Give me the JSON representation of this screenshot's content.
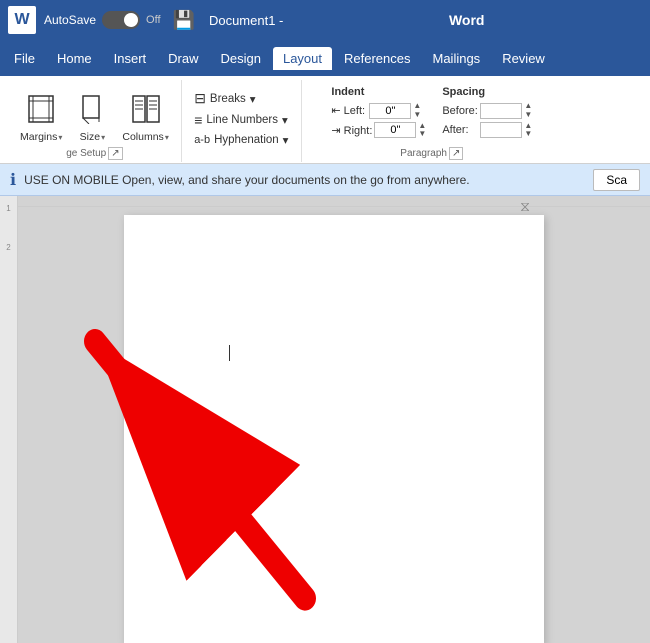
{
  "titlebar": {
    "logo": "W",
    "autosave_label": "AutoSave",
    "toggle_state": "Off",
    "save_label": "💾",
    "doc_name": "Document1",
    "separator": "  -  ",
    "app_name": "Word"
  },
  "menubar": {
    "items": [
      {
        "label": "File",
        "active": false
      },
      {
        "label": "Home",
        "active": false
      },
      {
        "label": "Insert",
        "active": false
      },
      {
        "label": "Draw",
        "active": false
      },
      {
        "label": "Design",
        "active": false
      },
      {
        "label": "Layout",
        "active": true
      },
      {
        "label": "References",
        "active": false
      },
      {
        "label": "Mailings",
        "active": false
      },
      {
        "label": "Review",
        "active": false
      }
    ]
  },
  "ribbon": {
    "page_setup": {
      "group_label": "ge Setup",
      "margins": {
        "label": "Margins",
        "caret": "▾"
      },
      "size": {
        "label": "Size",
        "caret": "▾"
      },
      "columns": {
        "label": "Columns",
        "caret": "▾"
      }
    },
    "page_setup_small": {
      "breaks": {
        "label": "Breaks",
        "caret": "▾"
      },
      "line_numbers": {
        "label": "Line Numbers",
        "caret": "▾"
      },
      "hyphenation": {
        "label": "Hyphenation",
        "caret": "▾"
      }
    },
    "indent": {
      "header": "Indent",
      "left_label": "⇤ Left:",
      "left_value": "0\"",
      "right_label": "⇥ Right:",
      "right_value": "0\""
    },
    "spacing": {
      "header": "Spacing",
      "before_label": "Before:",
      "before_value": "",
      "after_label": "After:",
      "after_value": ""
    },
    "paragraph_label": "Paragraph"
  },
  "infobar": {
    "icon": "ℹ",
    "message": "USE ON MOBILE  Open, view, and share your documents on the go from anywhere.",
    "button": "Sca"
  },
  "ruler": {
    "left_marks": [
      "1",
      "2"
    ],
    "top_marks": []
  },
  "arrow": {
    "description": "Red arrow pointing to Margins button"
  }
}
